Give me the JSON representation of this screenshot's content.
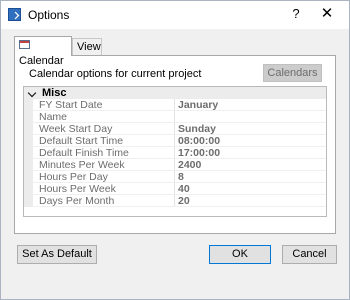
{
  "window": {
    "title": "Options",
    "help_label": "?",
    "close_label": "✕"
  },
  "tabs": [
    {
      "label": "Calendar",
      "active": true
    },
    {
      "label": "View",
      "active": false
    }
  ],
  "panel": {
    "description": "Calendar options for current project",
    "calendars_button": "Calendars"
  },
  "grid": {
    "category": "Misc",
    "properties": [
      {
        "name": "FY Start Date",
        "value": "January"
      },
      {
        "name": "Name",
        "value": ""
      },
      {
        "name": "Week Start Day",
        "value": "Sunday"
      },
      {
        "name": "Default Start Time",
        "value": "08:00:00"
      },
      {
        "name": "Default Finish Time",
        "value": "17:00:00"
      },
      {
        "name": "Minutes Per Week",
        "value": "2400"
      },
      {
        "name": "Hours Per Day",
        "value": "8"
      },
      {
        "name": "Hours Per Week",
        "value": "40"
      },
      {
        "name": "Days Per Month",
        "value": "20"
      }
    ]
  },
  "buttons": {
    "set_default": "Set As Default",
    "ok": "OK",
    "cancel": "Cancel"
  },
  "icons": {
    "app": "window-icon",
    "tab_calendar": "calendar-icon",
    "category": "chevron-down-icon"
  }
}
